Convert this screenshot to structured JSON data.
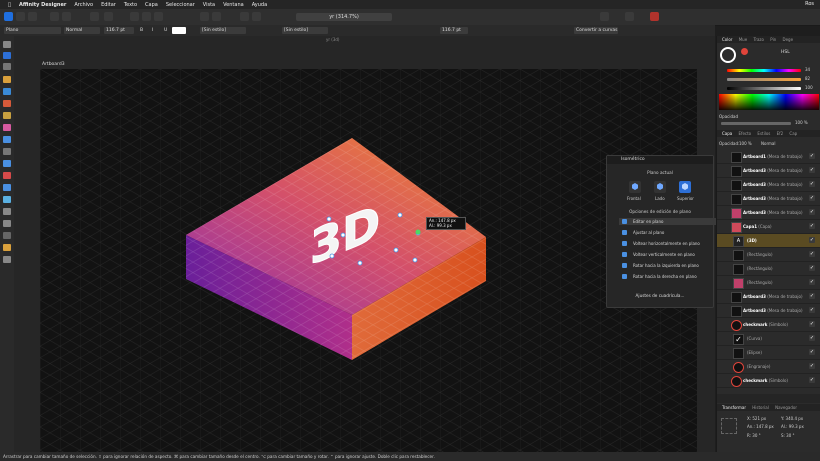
{
  "menubar": {
    "app": "Affinity Designer",
    "items": [
      "Archivo",
      "Editar",
      "Texto",
      "Capa",
      "Seleccionar",
      "Vista",
      "Ventana",
      "Ayuda"
    ],
    "user": "Ros"
  },
  "toolbar": {
    "doc_title": "yr (314.7%)",
    "convert_label": "Convertir a curvas"
  },
  "context": {
    "font_family": "Plano",
    "font_style": "Normal",
    "font_size": "116.7 pt",
    "bold": "B",
    "italic": "I",
    "underline": "U",
    "style1": "[Sin estilo]",
    "style2": "[Sin estilo]",
    "tracking": "116.7 pt",
    "ruler": "Artboard 1 (Ar)"
  },
  "canvas": {
    "artboard_name": "Artboard3",
    "label_3d": "3D",
    "tooltip_w": "An.: 147.8 px",
    "tooltip_h": "Al.: 99.3 px",
    "top_ruler": "yr (3d)"
  },
  "iso_panel": {
    "title": "Isométrico",
    "current_plane": "Plano actual",
    "planes": [
      "Frontal",
      "Lado",
      "Superior"
    ],
    "options_title": "Opciones de edición de plano",
    "options": [
      "Editar en plano",
      "Ajustar al plano",
      "Voltear horizontalmente en plano",
      "Voltear verticalmente en plano",
      "Rotar hacia la izquierda en plano",
      "Rotar hacia la derecha en plano"
    ],
    "grid_settings": "Ajustes de cuadrícula..."
  },
  "right_panel": {
    "color_tabs": [
      "Color",
      "Mue",
      "Trazo",
      "Pin",
      "Dege"
    ],
    "color_mode": "HSL",
    "h": "34",
    "s": "82",
    "l": "100",
    "opacity_label": "Opacidad",
    "opacity_value": "100 %",
    "layers_tabs": [
      "Capa",
      "Efecto",
      "Estilos",
      "Ef2",
      "Cap"
    ],
    "layer_opacity_label": "Opacidad:",
    "layer_opacity": "100 %",
    "blend": "Normal",
    "layers": [
      {
        "name": "Artboard1",
        "kind": "(Mesa de trabajo)",
        "sel": false
      },
      {
        "name": "Artboard3",
        "kind": "(Mesa de trabajo)",
        "sel": false
      },
      {
        "name": "Artboard3",
        "kind": "(Mesa de trabajo)",
        "sel": false
      },
      {
        "name": "Artboard3",
        "kind": "(Mesa de trabajo)",
        "sel": false
      },
      {
        "name": "Artboard3",
        "kind": "(Mesa de trabajo)",
        "sel": false
      },
      {
        "name": "Capa1",
        "kind": "(Capa)",
        "sel": false
      },
      {
        "name": "(3D)",
        "kind": "",
        "sel": true
      },
      {
        "name": "",
        "kind": "(Rectángulo)",
        "sel": false
      },
      {
        "name": "",
        "kind": "(Rectángulo)",
        "sel": false
      },
      {
        "name": "",
        "kind": "(Rectángulo)",
        "sel": false
      },
      {
        "name": "Artboard3",
        "kind": "(Mesa de trabajo)",
        "sel": false
      },
      {
        "name": "Artboard3",
        "kind": "(Mesa de trabajo)",
        "sel": false
      },
      {
        "name": "checkmark",
        "kind": "(Símbolo)",
        "sel": false
      },
      {
        "name": "",
        "kind": "(Curva)",
        "sel": false
      },
      {
        "name": "",
        "kind": "(Elipse)",
        "sel": false
      },
      {
        "name": "",
        "kind": "(Engranaje)",
        "sel": false
      },
      {
        "name": "checkmark",
        "kind": "(Símbolo)",
        "sel": false
      }
    ],
    "transform_tabs": [
      "Transformar",
      "Historial",
      "Navegador"
    ],
    "x": "X: 521 px",
    "y": "Y: 340.4 px",
    "w": "An.: 147.8 px",
    "hh": "Al.: 99.3 px",
    "r": "R: 30 °",
    "s2": "S: 30 °"
  },
  "statusbar": {
    "text": "Arrastrar para cambiar tamaño de selección. ⇧ para ignorar relación de aspecto. ⌘ para cambiar tamaño desde el centro. ⌥ para cambiar tamaño y rotar. ⌃ para ignorar ajuste. Doble clic para restablecer."
  }
}
